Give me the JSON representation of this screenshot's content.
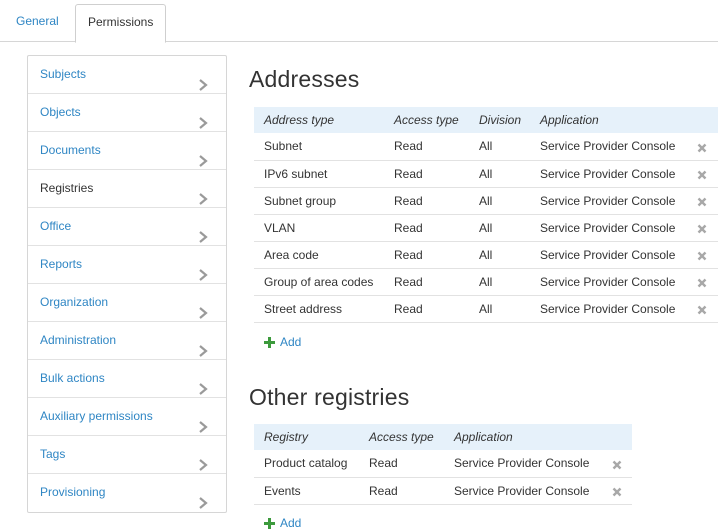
{
  "tabs": [
    {
      "label": "General",
      "active": false
    },
    {
      "label": "Permissions",
      "active": true
    }
  ],
  "sidebar": {
    "items": [
      {
        "label": "Subjects",
        "link": true
      },
      {
        "label": "Objects",
        "link": true
      },
      {
        "label": "Documents",
        "link": true
      },
      {
        "label": "Registries",
        "link": false
      },
      {
        "label": "Office",
        "link": true
      },
      {
        "label": "Reports",
        "link": true
      },
      {
        "label": "Organization",
        "link": true
      },
      {
        "label": "Administration",
        "link": true
      },
      {
        "label": "Bulk actions",
        "link": true
      },
      {
        "label": "Auxiliary permissions",
        "link": true
      },
      {
        "label": "Tags",
        "link": true
      },
      {
        "label": "Provisioning",
        "link": true
      }
    ]
  },
  "addresses": {
    "title": "Addresses",
    "columns": [
      "Address type",
      "Access type",
      "Division",
      "Application"
    ],
    "rows": [
      [
        "Subnet",
        "Read",
        "All",
        "Service Provider Console"
      ],
      [
        "IPv6 subnet",
        "Read",
        "All",
        "Service Provider Console"
      ],
      [
        "Subnet group",
        "Read",
        "All",
        "Service Provider Console"
      ],
      [
        "VLAN",
        "Read",
        "All",
        "Service Provider Console"
      ],
      [
        "Area code",
        "Read",
        "All",
        "Service Provider Console"
      ],
      [
        "Group of area codes",
        "Read",
        "All",
        "Service Provider Console"
      ],
      [
        "Street address",
        "Read",
        "All",
        "Service Provider Console"
      ]
    ],
    "add_label": "Add"
  },
  "other_registries": {
    "title": "Other registries",
    "columns": [
      "Registry",
      "Access type",
      "Application"
    ],
    "rows": [
      [
        "Product catalog",
        "Read",
        "Service Provider Console"
      ],
      [
        "Events",
        "Read",
        "Service Provider Console"
      ]
    ],
    "add_label": "Add"
  },
  "colors": {
    "link": "#2f86c4",
    "header_bg": "#e6f1fa",
    "add_icon": "#3c9a3c",
    "delete_icon": "#a8a8a8"
  }
}
